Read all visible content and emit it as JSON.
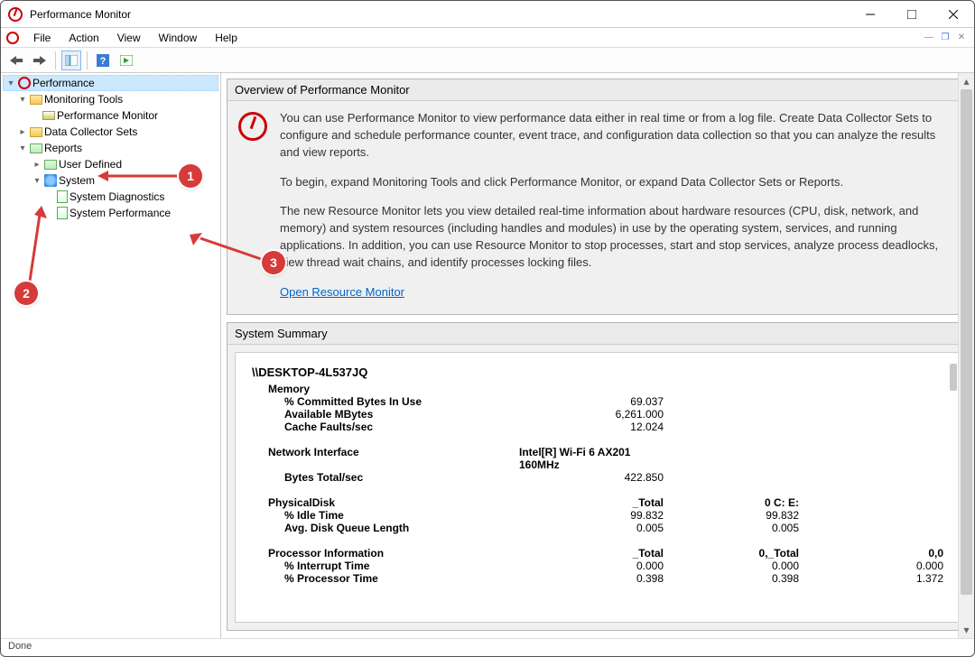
{
  "window": {
    "title": "Performance Monitor"
  },
  "menu": {
    "file": "File",
    "action": "Action",
    "view": "View",
    "window": "Window",
    "help": "Help"
  },
  "tree": {
    "root": "Performance",
    "monitoring": "Monitoring Tools",
    "perfmon": "Performance Monitor",
    "dcs": "Data Collector Sets",
    "reports": "Reports",
    "userdef": "User Defined",
    "system": "System",
    "sysdiag": "System Diagnostics",
    "sysperf": "System Performance"
  },
  "overview": {
    "header": "Overview of Performance Monitor",
    "p1": "You can use Performance Monitor to view performance data either in real time or from a log file. Create Data Collector Sets to configure and schedule performance counter, event trace, and configuration data collection so that you can analyze the results and view reports.",
    "p2": "To begin, expand Monitoring Tools and click Performance Monitor, or expand Data Collector Sets or Reports.",
    "p3": "The new Resource Monitor lets you view detailed real-time information about hardware resources (CPU, disk, network, and memory) and system resources (including handles and modules) in use by the operating system, services, and running applications. In addition, you can use Resource Monitor to stop processes, start and stop services, analyze process deadlocks, view thread wait chains, and identify processes locking files.",
    "link": "Open Resource Monitor"
  },
  "summary": {
    "header": "System Summary",
    "host": "\\\\DESKTOP-4L537JQ",
    "memory": {
      "label": "Memory",
      "committed": {
        "lbl": "% Committed Bytes In Use",
        "v": "69.037"
      },
      "avail": {
        "lbl": "Available MBytes",
        "v": "6,261.000"
      },
      "cache": {
        "lbl": "Cache Faults/sec",
        "v": "12.024"
      }
    },
    "net": {
      "label": "Network Interface",
      "iface": "Intel[R] Wi-Fi 6 AX201 160MHz",
      "bytes": {
        "lbl": "Bytes Total/sec",
        "v": "422.850"
      }
    },
    "disk": {
      "label": "PhysicalDisk",
      "h1": "_Total",
      "h2": "0 C: E:",
      "idle": {
        "lbl": "% Idle Time",
        "v1": "99.832",
        "v2": "99.832"
      },
      "queue": {
        "lbl": "Avg. Disk Queue Length",
        "v1": "0.005",
        "v2": "0.005"
      }
    },
    "proc": {
      "label": "Processor Information",
      "h1": "_Total",
      "h2": "0,_Total",
      "h3": "0,0",
      "intr": {
        "lbl": "% Interrupt Time",
        "v1": "0.000",
        "v2": "0.000",
        "v3": "0.000"
      },
      "ptime": {
        "lbl": "% Processor Time",
        "v1": "0.398",
        "v2": "0.398",
        "v3": "1.372"
      }
    }
  },
  "status": "Done",
  "annotations": {
    "c1": "1",
    "c2": "2",
    "c3": "3"
  }
}
